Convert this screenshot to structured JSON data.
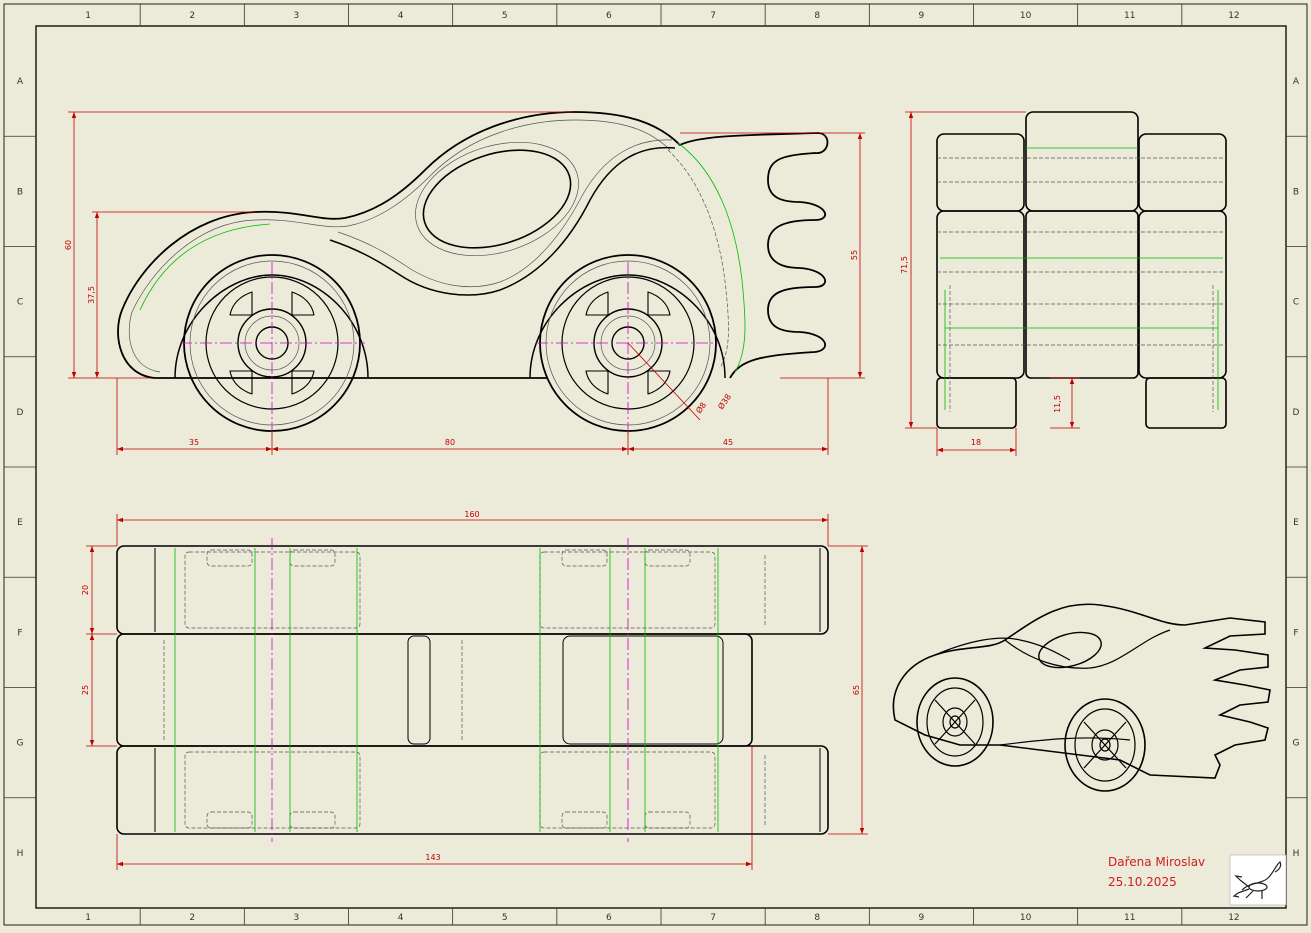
{
  "sheet": {
    "columns": [
      "1",
      "2",
      "3",
      "4",
      "5",
      "6",
      "7",
      "8",
      "9",
      "10",
      "11",
      "12"
    ],
    "rows": [
      "A",
      "B",
      "C",
      "D",
      "E",
      "F",
      "G",
      "H"
    ]
  },
  "dimensions": {
    "overall_height": "60",
    "wheel_center_height": "37,5",
    "tail_height": "55",
    "front_overhang": "35",
    "wheelbase": "80",
    "rear_overhang": "45",
    "hub_diameter": "Ø8",
    "wheel_diameter": "Ø38",
    "side_height": "71,5",
    "wheel_width": "18",
    "ground_clearance": "11,5",
    "overall_length": "160",
    "wheel_track_part": "20",
    "body_width": "25",
    "overall_width": "65",
    "body_length": "143"
  },
  "signature": {
    "author": "Dařena Miroslav",
    "date": "25.10.2025"
  },
  "colors": {
    "paper": "#ecead8",
    "outline": "#000000",
    "hidden": "#555555",
    "tangent": "#00bb00",
    "centerline": "#cc00cc",
    "dimension": "#c00000"
  }
}
